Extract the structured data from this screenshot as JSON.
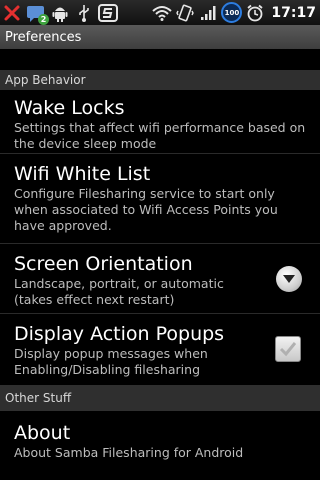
{
  "status_bar": {
    "time": "17:17",
    "battery": "100",
    "notification_count": "2",
    "icons": [
      "missed-call-icon",
      "message-icon",
      "android-icon",
      "usb-icon",
      "s-app-icon",
      "wifi-icon",
      "vibrate-icon",
      "signal-icon",
      "battery-icon",
      "alarm-icon"
    ]
  },
  "title": "Preferences",
  "sections": {
    "app_behavior": {
      "header": "App Behavior",
      "items": [
        {
          "title": "Wake Locks",
          "summary": "Settings that affect wifi performance based on the device sleep mode"
        },
        {
          "title": "Wifi White List",
          "summary": "Configure Filesharing service to start only when associated to Wifi Access Points you have approved."
        },
        {
          "title": "Screen Orientation",
          "summary": "Landscape, portrait, or automatic (takes effect next restart)"
        },
        {
          "title": "Display Action Popups",
          "summary": "Display popup messages when Enabling/Disabling filesharing",
          "checked": true
        }
      ]
    },
    "other_stuff": {
      "header": "Other Stuff",
      "items": [
        {
          "title": "About",
          "summary": "About Samba Filesharing for Android"
        }
      ]
    }
  },
  "colors": {
    "background": "#000000",
    "header_bg": "#2f2f2f",
    "titlebar_bg": "#4a4a4a",
    "accent_blue": "#2d7de0"
  }
}
